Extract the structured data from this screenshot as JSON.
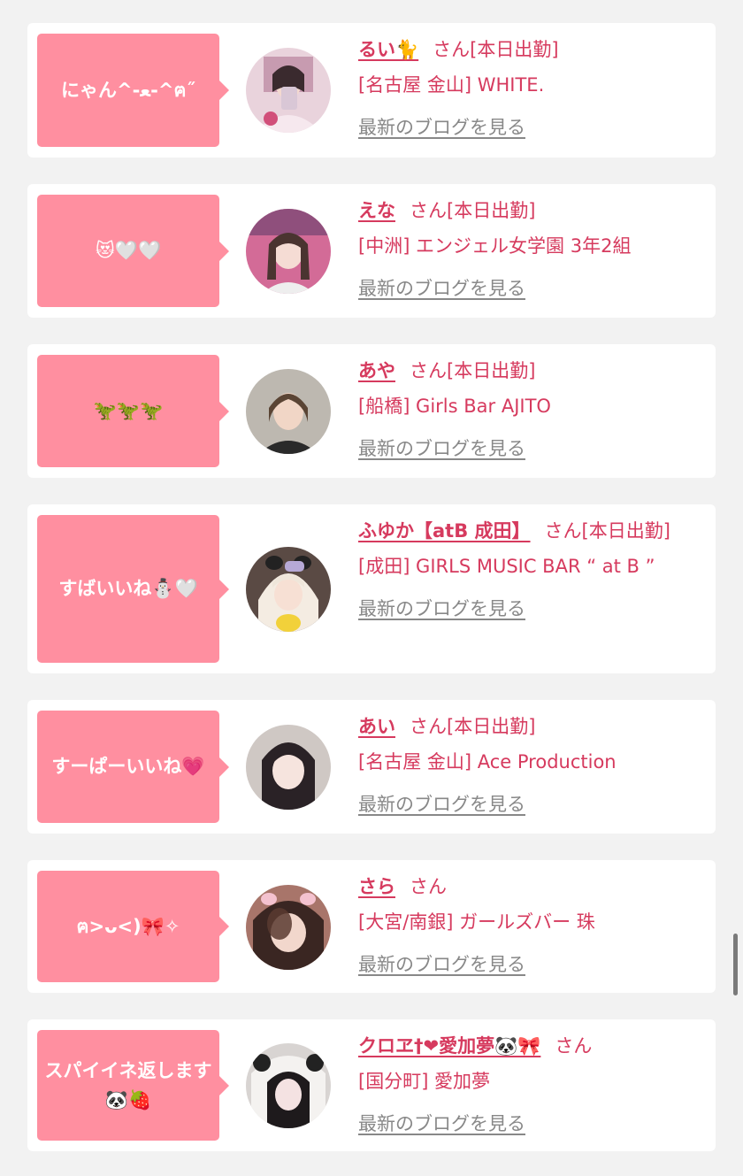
{
  "cards": [
    {
      "comment": "にゃん^-ﻌ-^ฅ˝",
      "name": "るい🐈",
      "honorific": "さん",
      "status": "[本日出勤]",
      "shop": "[名古屋 金山] WHITE.",
      "blog_link": "最新のブログを見る"
    },
    {
      "comment": "😻🤍🤍",
      "name": "えな",
      "honorific": "さん",
      "status": "[本日出勤]",
      "shop": "[中洲] エンジェル女学園 3年2組",
      "blog_link": "最新のブログを見る"
    },
    {
      "comment": "🦖🦖🦖",
      "name": "あや",
      "honorific": "さん",
      "status": "[本日出勤]",
      "shop": "[船橋] Girls Bar AJITO",
      "blog_link": "最新のブログを見る"
    },
    {
      "comment": "すばいいね⛄🤍",
      "name": "ふゆか【atB 成田】",
      "honorific": "さん",
      "status": "[本日出勤]",
      "shop": "[成田] GIRLS MUSIC BAR “ at B ”",
      "blog_link": "最新のブログを見る"
    },
    {
      "comment": "すーぱーいいね💗",
      "name": "あい",
      "honorific": "さん",
      "status": "[本日出勤]",
      "shop": "[名古屋 金山] Ace Production",
      "blog_link": "最新のブログを見る"
    },
    {
      "comment": "ฅ>ᴗ<)🎀✧",
      "name": "さら",
      "honorific": "さん",
      "status": "",
      "shop": "[大宮/南銀] ガールズバー 珠",
      "blog_link": "最新のブログを見る"
    },
    {
      "comment": "スパイイネ返します🐼🍓",
      "name": "クロヱ†❤愛加夢🐼🎀",
      "honorific": "さん",
      "status": "",
      "shop": "[国分町] 愛加夢",
      "blog_link": "最新のブログを見る"
    }
  ],
  "colors": {
    "page_background": "#f2f2f2",
    "card_background": "#ffffff",
    "bubble": "#ff8fa0",
    "accent_text": "#d63a5e",
    "link_gray": "#888888"
  }
}
